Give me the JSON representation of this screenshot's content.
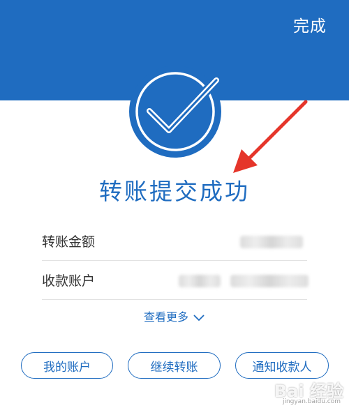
{
  "header": {
    "done_label": "完成",
    "color": "#1f6cc0"
  },
  "status": {
    "icon": "checkmark-circle-icon",
    "title": "转账提交成功"
  },
  "details": {
    "rows": [
      {
        "label": "转账金额"
      },
      {
        "label": "收款账户"
      }
    ],
    "more_label": "查看更多"
  },
  "actions": {
    "buttons": [
      {
        "label": "我的账户"
      },
      {
        "label": "继续转账"
      },
      {
        "label": "通知收款人"
      }
    ]
  },
  "annotation": {
    "icon": "red-arrow-icon",
    "color": "#e5352a"
  },
  "watermark": {
    "text": "Bai 经验",
    "sub": "jingyan.baidu.com"
  }
}
